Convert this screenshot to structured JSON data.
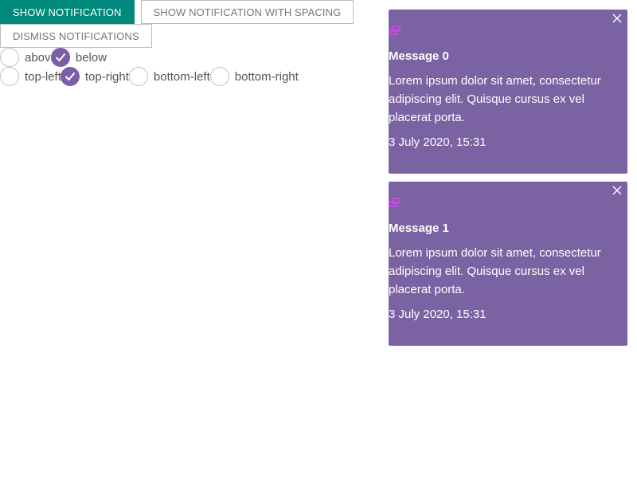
{
  "buttons": {
    "show": "Show notification",
    "show_spacing": "Show notification with spacing",
    "dismiss": "Dismiss notifications"
  },
  "vertical_options": [
    {
      "label": "above",
      "checked": false
    },
    {
      "label": "below",
      "checked": true
    }
  ],
  "position_options": [
    {
      "label": "top-left",
      "checked": false
    },
    {
      "label": "top-right",
      "checked": true
    },
    {
      "label": "bottom-left",
      "checked": false
    },
    {
      "label": "bottom-right",
      "checked": true
    }
  ],
  "notifications": [
    {
      "title": "Message 0",
      "body": "Lorem ipsum dolor sit amet, consectetur adipiscing elit. Quisque cursus ex vel placerat porta.",
      "time": "3 July 2020, 15:31"
    },
    {
      "title": "Message 1",
      "body": "Lorem ipsum dolor sit amet, consectetur adipiscing elit. Quisque cursus ex vel placerat porta.",
      "time": "3 July 2020, 15:31"
    }
  ],
  "colors": {
    "primary_button": "#00897b",
    "radio_checked": "#7b5ea7",
    "notification_bg": "#7b62a3",
    "pin_icon": "#e040fb"
  }
}
